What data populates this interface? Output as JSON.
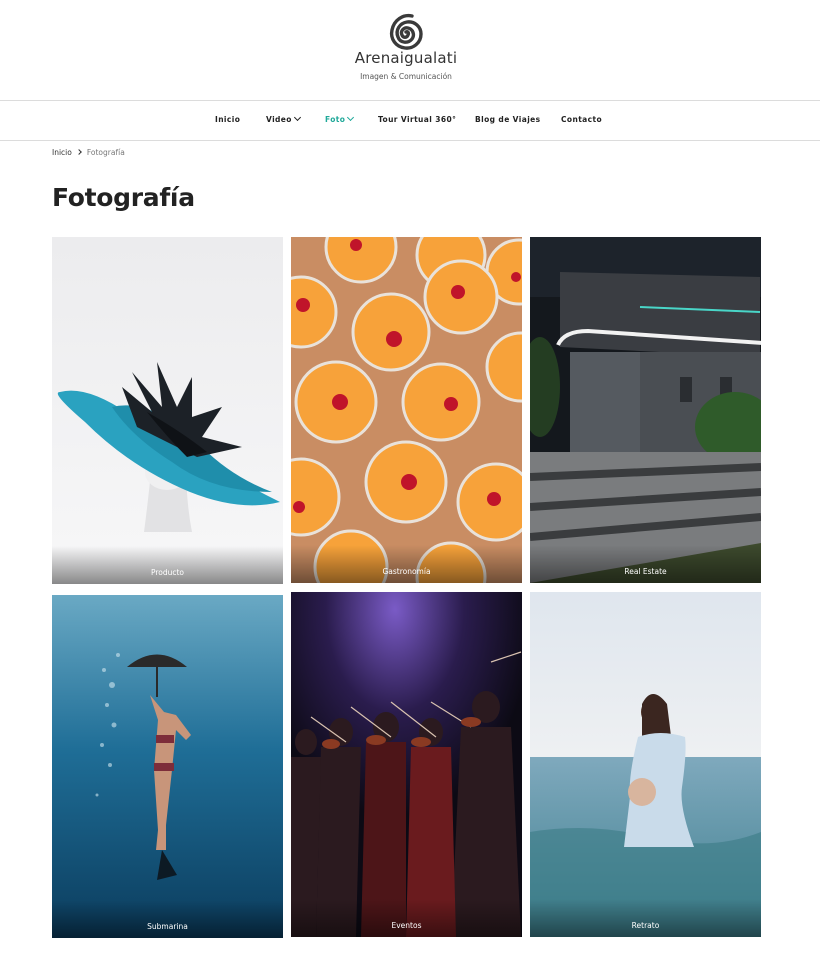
{
  "header": {
    "brand": "Arenaigualati",
    "tagline": "Imagen & Comunicación",
    "logo_icon": "spiral-logo-icon"
  },
  "nav": {
    "items": [
      {
        "label": "Inicio",
        "has_dropdown": false
      },
      {
        "label": "Video",
        "has_dropdown": true
      },
      {
        "label": "Foto",
        "has_dropdown": true,
        "active": true
      },
      {
        "label": "Tour Virtual 360°",
        "has_dropdown": false
      },
      {
        "label": "Blog de Viajes",
        "has_dropdown": false
      },
      {
        "label": "Contacto",
        "has_dropdown": false
      }
    ],
    "active_color": "#20a99a"
  },
  "breadcrumb": {
    "home": "Inicio",
    "current": "Fotografía"
  },
  "page": {
    "title": "Fotografía"
  },
  "gallery": {
    "items": [
      {
        "label": "Producto"
      },
      {
        "label": "Gastronomía"
      },
      {
        "label": "Real Estate"
      },
      {
        "label": "Submarina"
      },
      {
        "label": "Eventos"
      },
      {
        "label": "Retrato"
      }
    ]
  }
}
